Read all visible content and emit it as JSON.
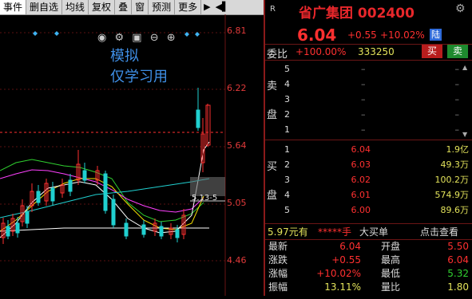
{
  "toolbar": {
    "items": [
      "事件",
      "删自选",
      "均线",
      "复权",
      "叠",
      "窗",
      "预测",
      "更多"
    ],
    "active_index": 0
  },
  "chart": {
    "price_labels": [
      "6.81",
      "6.22",
      "5.64",
      "5.05",
      "4.46"
    ],
    "overlay_line1": "模拟",
    "overlay_line2": "仅学习用",
    "cursor_label": "5.13-5",
    "icons": [
      "eye-icon",
      "gear-icon",
      "tool-icon",
      "minus-icon",
      "plus-icon"
    ],
    "colors": {
      "up": "#ff3030",
      "down": "#20d0d0",
      "ma5": "#ffffff",
      "ma10": "#f5e000",
      "ma20": "#ff40ff",
      "ma60": "#30d030"
    }
  },
  "quote": {
    "badge": "R",
    "name": "省广集团",
    "code": "002400",
    "price": "6.04",
    "change": "+0.55",
    "change_pct": "+10.02%",
    "exchange_badge": "陆"
  },
  "weibi": {
    "label": "委比",
    "pct": "+100.00%",
    "diff": "333250",
    "buy_label": "买",
    "sell_label": "卖"
  },
  "sell_side": {
    "label1": "卖",
    "label2": "盘",
    "rows": [
      {
        "idx": "5",
        "price": "–",
        "vol": "–"
      },
      {
        "idx": "4",
        "price": "–",
        "vol": "–"
      },
      {
        "idx": "3",
        "price": "–",
        "vol": "–"
      },
      {
        "idx": "2",
        "price": "–",
        "vol": "–"
      },
      {
        "idx": "1",
        "price": "–",
        "vol": "–"
      }
    ]
  },
  "buy_side": {
    "label1": "买",
    "label2": "盘",
    "rows": [
      {
        "idx": "1",
        "price": "6.04",
        "vol": "1.9亿"
      },
      {
        "idx": "2",
        "price": "6.03",
        "vol": "49.3万"
      },
      {
        "idx": "3",
        "price": "6.02",
        "vol": "100.2万"
      },
      {
        "idx": "4",
        "price": "6.01",
        "vol": "574.9万"
      },
      {
        "idx": "5",
        "price": "6.00",
        "vol": "89.6万"
      }
    ]
  },
  "trade": {
    "price_text": "5.97元有",
    "stars": "*****手",
    "big_order": "大买单",
    "link": "点击查看"
  },
  "stats": [
    {
      "l1": "最新",
      "v1": "6.04",
      "c1": "#ff3030",
      "l2": "开盘",
      "v2": "5.50",
      "c2": "#ff3030"
    },
    {
      "l1": "涨跌",
      "v1": "+0.55",
      "c1": "#ff3030",
      "l2": "最高",
      "v2": "6.04",
      "c2": "#ff3030"
    },
    {
      "l1": "涨幅",
      "v1": "+10.02%",
      "c1": "#ff3030",
      "l2": "最低",
      "v2": "5.32",
      "c2": "#30d030"
    },
    {
      "l1": "振幅",
      "v1": "13.11%",
      "c1": "#e2e25a",
      "l2": "量比",
      "v2": "1.80",
      "c2": "#e2e25a"
    }
  ]
}
